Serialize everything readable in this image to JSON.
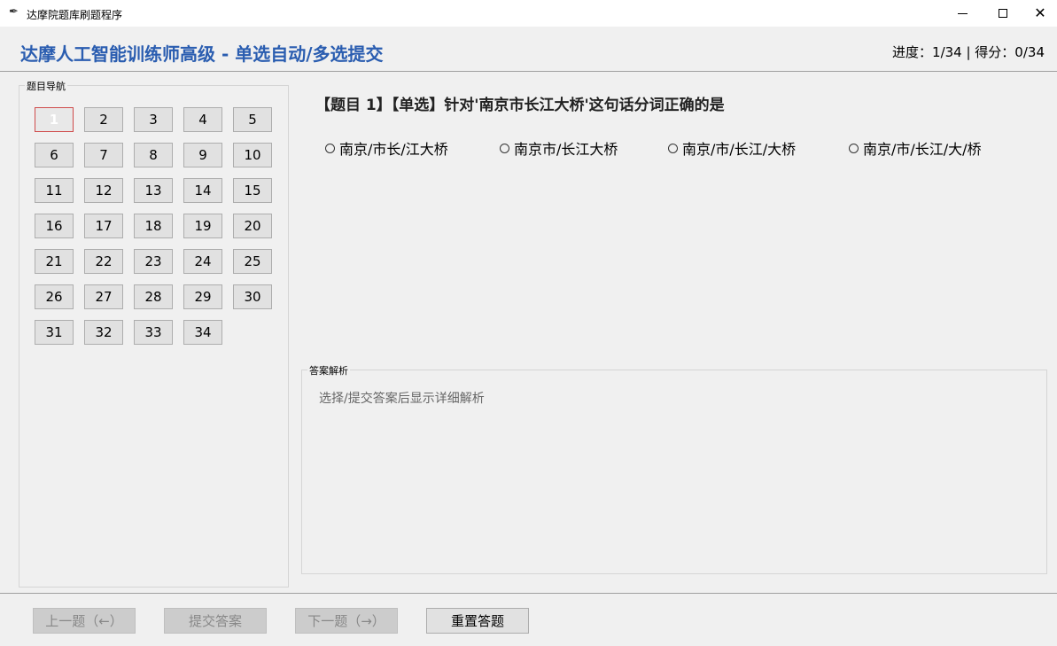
{
  "window": {
    "title": "达摩院题库刷题程序",
    "icon": "feather-icon",
    "close_glyph": "✕"
  },
  "header": {
    "heading": "达摩人工智能训练师高级 - 单选自动/多选提交",
    "progress": "进度：1/34 | 得分：0/34"
  },
  "nav": {
    "label": "题目导航",
    "current": 1,
    "numbers": [
      "1",
      "2",
      "3",
      "4",
      "5",
      "6",
      "7",
      "8",
      "9",
      "10",
      "11",
      "12",
      "13",
      "14",
      "15",
      "16",
      "17",
      "18",
      "19",
      "20",
      "21",
      "22",
      "23",
      "24",
      "25",
      "26",
      "27",
      "28",
      "29",
      "30",
      "31",
      "32",
      "33",
      "34"
    ]
  },
  "question": {
    "text": "【题目 1】【单选】针对'南京市长江大桥'这句话分词正确的是",
    "options": [
      "南京/市长/江大桥",
      "南京市/长江大桥",
      "南京/市/长江/大桥",
      "南京/市/长江/大/桥"
    ]
  },
  "explanation": {
    "label": "答案解析",
    "placeholder": "选择/提交答案后显示详细解析"
  },
  "footer": {
    "prev": "上一题（←）",
    "submit": "提交答案",
    "next": "下一题（→）",
    "reset": "重置答题"
  },
  "colors": {
    "accent": "#2a5db0",
    "current_border": "#cf4b4b"
  }
}
